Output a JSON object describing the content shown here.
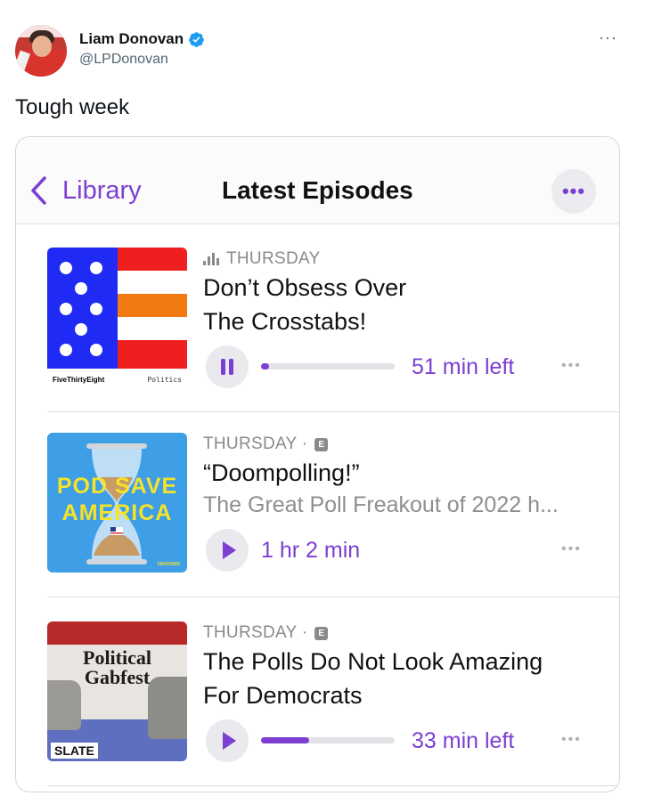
{
  "tweet": {
    "author_name": "Liam Donovan",
    "handle": "@LPDonovan",
    "text": "Tough week",
    "more": "···"
  },
  "app": {
    "back_label": "Library",
    "title": "Latest Episodes",
    "more": "•••",
    "accent": "#7d3fd1"
  },
  "episodes": [
    {
      "show_art_left": "FiveThirtyEight",
      "show_art_right": "Politics",
      "day": "THURSDAY",
      "title_line1": "Don’t Obsess Over",
      "title_line2": "The Crosstabs!",
      "state": "playing",
      "progress_fraction": 0.06,
      "time": "51 min left",
      "more": "•••"
    },
    {
      "show_art_line1": "POD SAVE",
      "show_art_line2": "AMERICA",
      "show_art_mark": "CROOKED",
      "day": "THURSDAY · ",
      "explicit": "E",
      "title": "“Doompolling!”",
      "description": "The Great Poll Freakout of 2022 h...",
      "state": "paused",
      "time": "1 hr 2 min",
      "more": "•••"
    },
    {
      "show_art_line1": "Political",
      "show_art_line2": "Gabfest",
      "show_art_brand": "SLATE",
      "day": "THURSDAY · ",
      "explicit": "E",
      "title_line1": "The Polls Do Not Look Amazing",
      "title_line2": "For Democrats",
      "state": "paused",
      "progress_fraction": 0.36,
      "time": "33 min left",
      "more": "•••"
    }
  ]
}
